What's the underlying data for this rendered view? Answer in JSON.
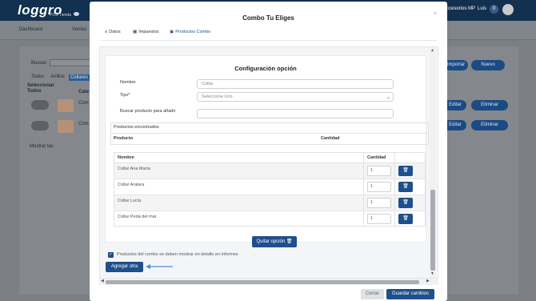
{
  "background": {
    "logo": "loggro",
    "logo_sub": "POS Tienda",
    "nav_right": "ccesorios MP",
    "nav_user": "Luis",
    "badge": "0",
    "sub_items": [
      "Dashboard",
      "Ventas"
    ],
    "search_label": "Buscar:",
    "filters": [
      "Todos",
      "Anillos",
      "Collares"
    ],
    "col_select": "Seleccionar Todos",
    "col_cat": "Cate",
    "row_text": "Com",
    "editar": "Editar",
    "eliminar": "Eliminar",
    "importar": "Importar",
    "nuevo": "Nuevo",
    "mostrar": "Mostrar las"
  },
  "modal": {
    "title": "Combo Tu Eliges",
    "close": "×",
    "tabs": [
      {
        "icon": "≡",
        "label": "Datos"
      },
      {
        "icon": "▦",
        "label": "Impuestos"
      },
      {
        "icon": "▣",
        "label": "Productos Combo"
      }
    ],
    "config": {
      "title": "Configuración opción",
      "nombre_label": "Nombre",
      "nombre_value": "Collar",
      "tipo_label": "Tipo*",
      "tipo_value": "Seleccione Uno",
      "buscar_label": "Buscar producto para añadir",
      "buscar_value": ""
    },
    "found": {
      "title": "Productos encontrados",
      "col_producto": "Producto",
      "col_cantidad": "Cantidad"
    },
    "table": {
      "col_nombre": "Nombre",
      "col_cantidad": "Cantidad",
      "rows": [
        {
          "name": "Collar Ana María",
          "qty": "1"
        },
        {
          "name": "Collar Aralara",
          "qty": "1"
        },
        {
          "name": "Collar Lucía",
          "qty": "1"
        },
        {
          "name": "Collar Perla del mar",
          "qty": "1"
        }
      ],
      "delete_icon": "🗑"
    },
    "quitar": "Quitar opción",
    "checkbox_label": "Productos del combo se deben mostrar en detalle en informes",
    "agregar": "Agregar otra",
    "cerrar": "Cerrar",
    "guardar": "Guardar cambios"
  },
  "colors": {
    "primary": "#1f4f8c",
    "navbar": "#12304f",
    "overlay": "#7b7f84"
  }
}
